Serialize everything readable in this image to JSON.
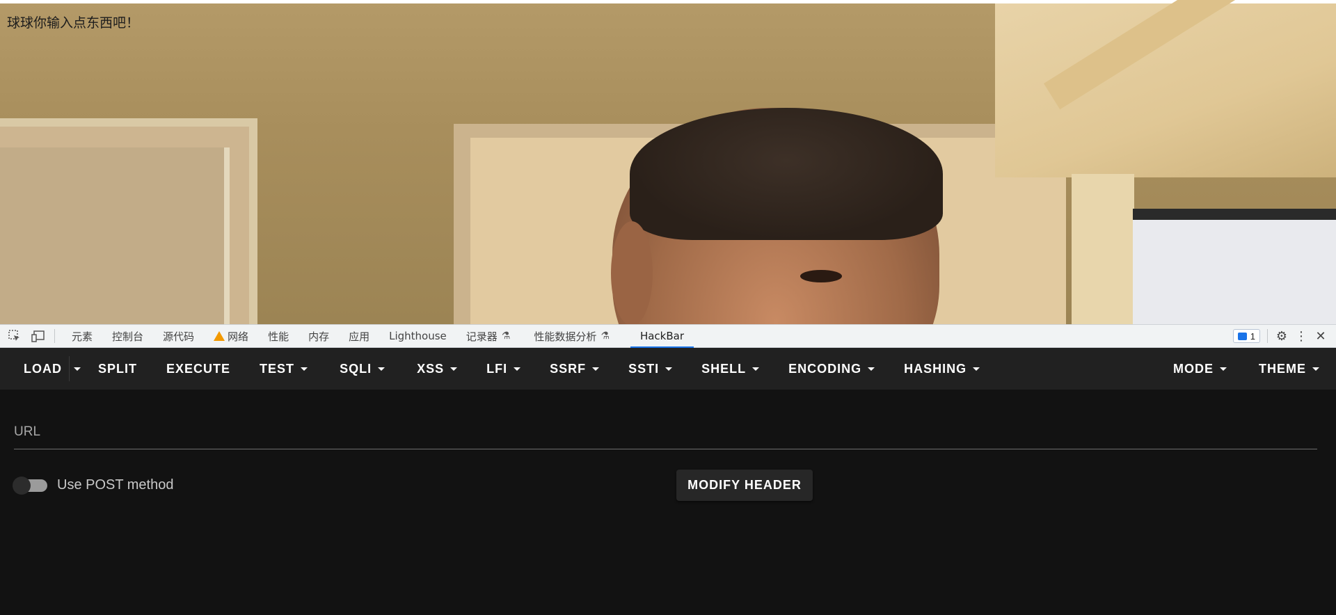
{
  "page": {
    "message": "球球你输入点东西吧！"
  },
  "devtools": {
    "tabs": [
      {
        "label": "元素"
      },
      {
        "label": "控制台"
      },
      {
        "label": "源代码"
      },
      {
        "label": "网络"
      },
      {
        "label": "性能"
      },
      {
        "label": "内存"
      },
      {
        "label": "应用"
      },
      {
        "label": "Lighthouse"
      },
      {
        "label": "记录器"
      },
      {
        "label": "性能数据分析"
      },
      {
        "label": "HackBar"
      }
    ],
    "active_tab": "HackBar",
    "issues_count": "1",
    "accent_color": "#1a73e8",
    "warning_color": "#f29900"
  },
  "hackbar": {
    "toolbar": {
      "load": "LOAD",
      "split": "SPLIT",
      "execute": "EXECUTE",
      "test": "TEST",
      "sqli": "SQLI",
      "xss": "XSS",
      "lfi": "LFI",
      "ssrf": "SSRF",
      "ssti": "SSTI",
      "shell": "SHELL",
      "encoding": "ENCODING",
      "hashing": "HASHING",
      "mode": "MODE",
      "theme": "THEME"
    },
    "url_label": "URL",
    "url_value": "",
    "post_method_label": "Use POST method",
    "post_method_enabled": false,
    "modify_header": "MODIFY HEADER",
    "background_color": "#121212",
    "toolbar_color": "#212121"
  }
}
